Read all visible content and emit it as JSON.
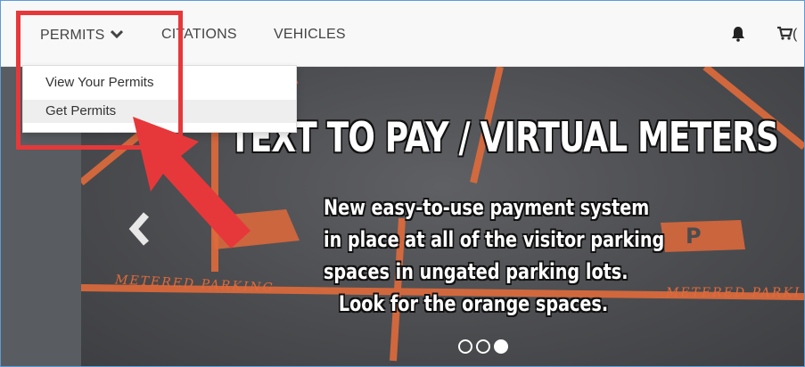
{
  "nav": {
    "permits_label": "PERMITS",
    "citations_label": "CITATIONS",
    "vehicles_label": "VEHICLES",
    "cart_text": "("
  },
  "dropdown": {
    "items": [
      {
        "label": "View Your Permits"
      },
      {
        "label": "Get Permits"
      }
    ]
  },
  "slide": {
    "title": "TEXT TO PAY / VIRTUAL METERS",
    "body_lines": [
      "New easy-to-use payment system",
      "in place at all of the visitor parking",
      "spaces in ungated parking lots.",
      "Look for the orange spaces."
    ],
    "painted_left": "METERED PARKING",
    "painted_right": "METERED PARKI",
    "carousel_count": 3,
    "carousel_active_index": 2
  },
  "colors": {
    "annotation_red": "#e6383a",
    "paint_orange": "#e06a3b"
  },
  "icons": {
    "chevron": "chevron-down-icon",
    "bell": "bell-icon",
    "cart": "cart-icon",
    "prev": "chevron-left-icon"
  }
}
